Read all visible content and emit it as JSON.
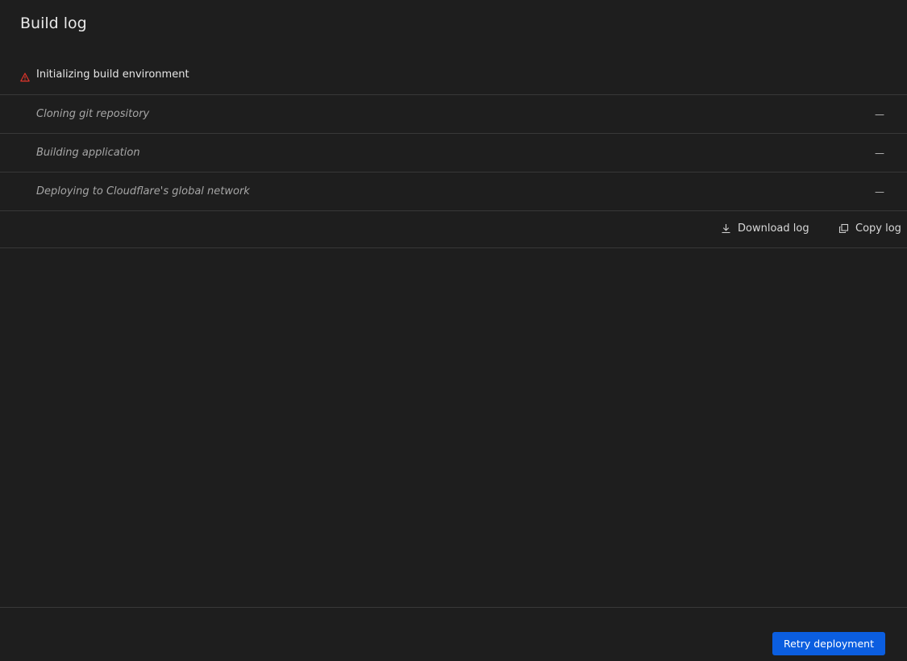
{
  "header": {
    "title": "Build log"
  },
  "steps": [
    {
      "label": "Initializing build environment",
      "state": "error",
      "status": "",
      "icon": "warning-icon"
    },
    {
      "label": "Cloning git repository",
      "state": "pending",
      "status": "—"
    },
    {
      "label": "Building application",
      "state": "pending",
      "status": "—"
    },
    {
      "label": "Deploying to Cloudflare's global network",
      "state": "pending",
      "status": "—"
    }
  ],
  "actions": {
    "download_label": "Download log",
    "download_icon": "download-icon",
    "copy_label": "Copy log",
    "copy_icon": "copy-icon"
  },
  "footer": {
    "retry_label": "Retry deployment"
  },
  "colors": {
    "background": "#1e1e1e",
    "divider": "#383838",
    "error": "#e0352b",
    "primary_button": "#0b5ee0"
  }
}
